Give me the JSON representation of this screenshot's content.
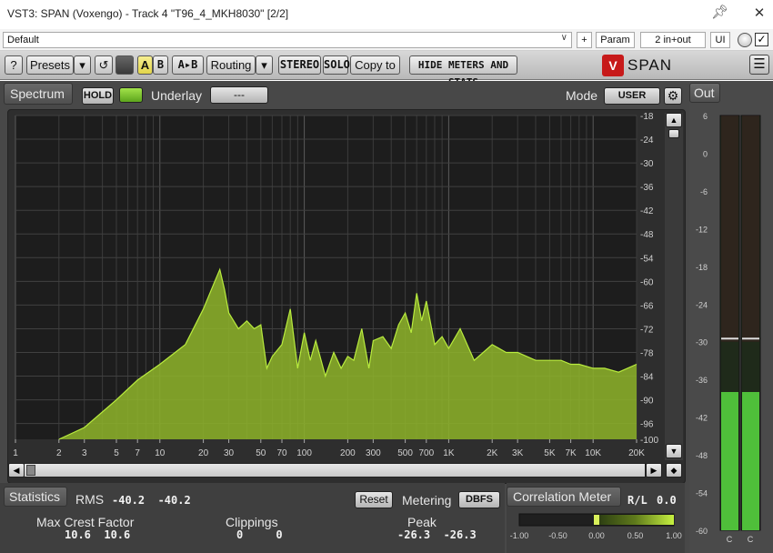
{
  "window": {
    "title": "VST3: SPAN (Voxengo) - Track 4 \"T96_4_MKH8030\" [2/2]",
    "pin_icon": "pin-icon",
    "close_icon": "close-icon"
  },
  "host": {
    "preset_value": "Default",
    "plus_label": "+",
    "param_label": "Param",
    "io_label": "2 in+out",
    "ui_label": "UI",
    "bypass_checked": true
  },
  "toolbar": {
    "help_label": "?",
    "presets_label": "Presets",
    "dropdown_arrow": "▾",
    "undo_glyph": "↺",
    "a_label": "A",
    "b_label": "B",
    "ab_label": "A▸B",
    "routing_label": "Routing",
    "stereo_label": "STEREO",
    "solo_label": "SOLO",
    "copy_label": "Copy to",
    "hide_label": "HIDE METERS AND STATS",
    "logo_letter": "V",
    "logo_text": "SPAN",
    "menu_glyph": "☰"
  },
  "spectrum": {
    "section_label": "Spectrum",
    "hold_label": "HOLD",
    "underlay_label": "Underlay",
    "underlay_value": "---",
    "mode_label": "Mode",
    "mode_value": "USER",
    "gear_glyph": "⚙",
    "fill_color": "#8fb52a",
    "line_color": "#b9ec3e"
  },
  "chart_data": {
    "type": "area",
    "title": "",
    "xlabel": "",
    "ylabel": "",
    "x_scale": "log",
    "xlim": [
      1,
      20000
    ],
    "ylim": [
      -100,
      -18
    ],
    "x_tick_labels": [
      "1",
      "2",
      "3",
      "5",
      "7",
      "10",
      "20",
      "30",
      "50",
      "70",
      "100",
      "200",
      "300",
      "500",
      "700",
      "1K",
      "2K",
      "3K",
      "5K",
      "7K",
      "10K",
      "20K"
    ],
    "y_tick_labels": [
      "-18",
      "-24",
      "-30",
      "-36",
      "-42",
      "-48",
      "-54",
      "-60",
      "-66",
      "-72",
      "-78",
      "-84",
      "-90",
      "-96",
      "-100"
    ],
    "grid": true,
    "series": [
      {
        "x": [
          2,
          3,
          5,
          7,
          10,
          15,
          20,
          24,
          26,
          28,
          30,
          35,
          40,
          45,
          50,
          55,
          60,
          70,
          80,
          90,
          100,
          110,
          120,
          140,
          160,
          180,
          200,
          220,
          250,
          280,
          300,
          350,
          400,
          450,
          500,
          550,
          600,
          650,
          700,
          800,
          900,
          1000,
          1200,
          1500,
          2000,
          2500,
          3000,
          4000,
          5000,
          6000,
          7000,
          8000,
          10000,
          12000,
          15000,
          20000
        ],
        "y": [
          -100,
          -97,
          -90,
          -85,
          -81,
          -76,
          -67,
          -60,
          -57,
          -62,
          -68,
          -72,
          -70,
          -72,
          -71,
          -82,
          -79,
          -76,
          -67,
          -82,
          -73,
          -80,
          -75,
          -84,
          -78,
          -82,
          -79,
          -80,
          -72,
          -82,
          -75,
          -74,
          -77,
          -71,
          -68,
          -73,
          -63,
          -70,
          -65,
          -76,
          -74,
          -77,
          -72,
          -80,
          -76,
          -78,
          -78,
          -80,
          -80,
          -80,
          -81,
          -81,
          -82,
          -82,
          -83,
          -81
        ]
      }
    ]
  },
  "scroll": {
    "up_glyph": "▲",
    "down_glyph": "▼",
    "left_glyph": "◀",
    "right_glyph": "▶",
    "diamond_glyph": "◆"
  },
  "stats": {
    "section_label": "Statistics",
    "rms_label": "RMS",
    "rms_values": "-40.2  -40.2",
    "reset_label": "Reset",
    "metering_label": "Metering",
    "metering_value": "DBFS",
    "crest_label": "Max Crest Factor",
    "crest_values": "10.6  10.6",
    "clip_label": "Clippings",
    "clip_values": "0     0",
    "peak_label": "Peak",
    "peak_values": "-26.3  -26.3"
  },
  "correlation": {
    "label": "Correlation Meter",
    "rl_label": "R/L",
    "value": "0.0",
    "scale": [
      "-1.00",
      "-0.50",
      "0.00",
      "0.50",
      "1.00"
    ],
    "level": 0.5
  },
  "out": {
    "label": "Out",
    "scale": [
      "6",
      "0",
      "-6",
      "-12",
      "-18",
      "-24",
      "-30",
      "-36",
      "-42",
      "-48",
      "-54",
      "-60"
    ],
    "channels": [
      "C",
      "C"
    ],
    "level_db": -38,
    "peak_db": -29.5,
    "meter_color": "#4fbf3a"
  }
}
